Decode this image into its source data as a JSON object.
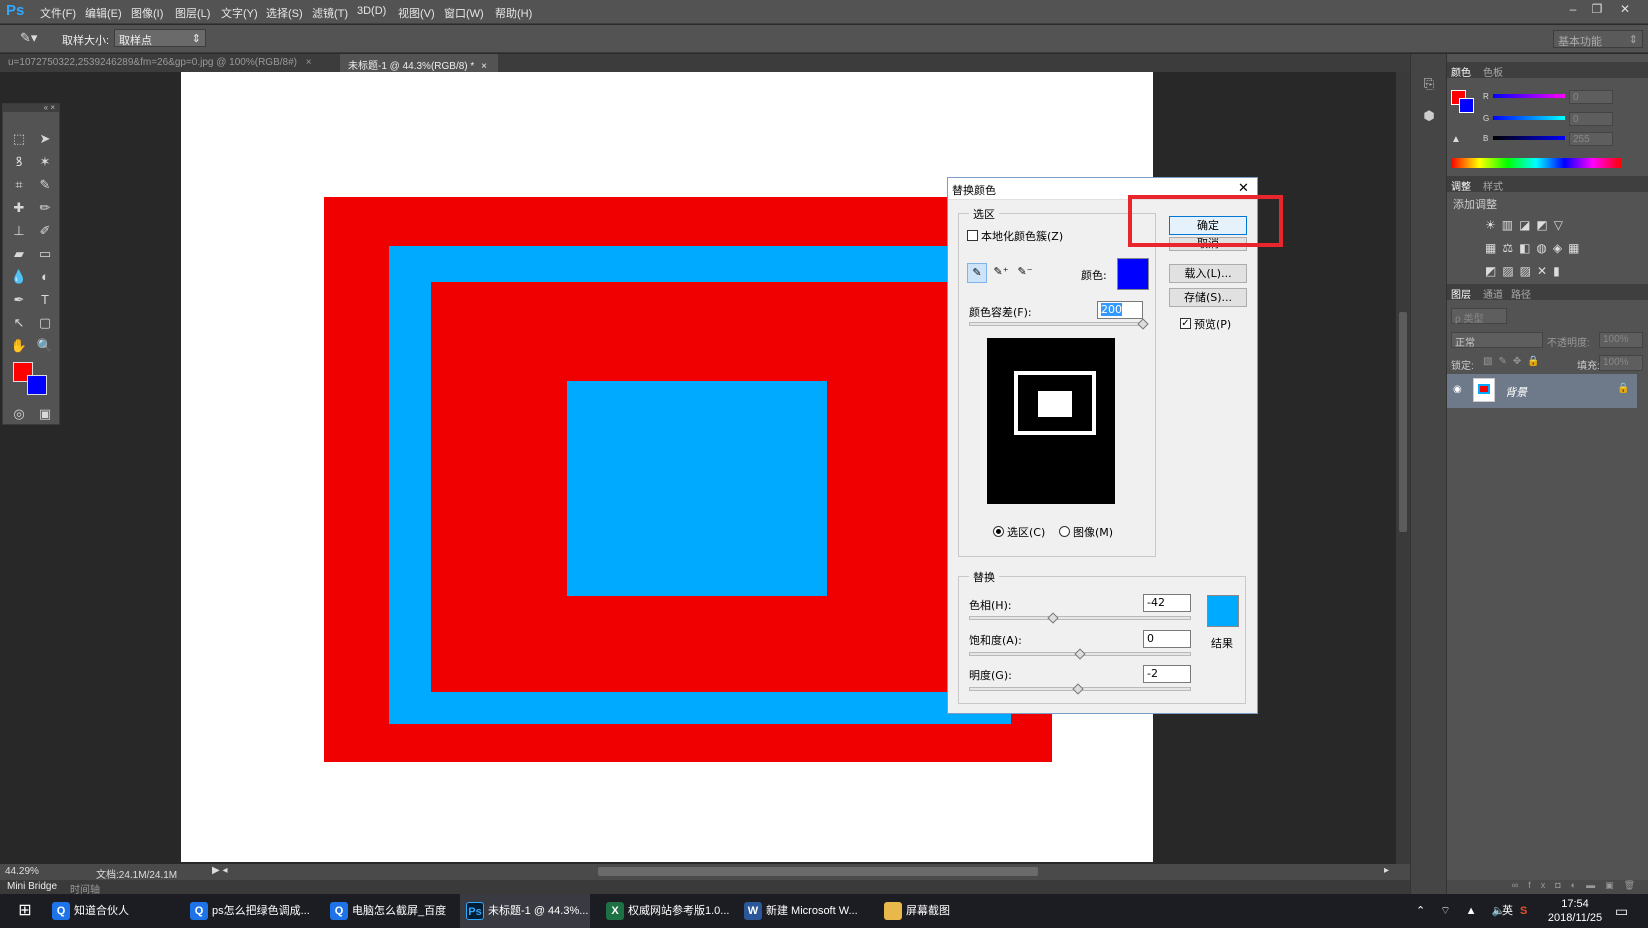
{
  "app": {
    "logo": "Ps"
  },
  "menu": [
    "文件(F)",
    "编辑(E)",
    "图像(I)",
    "图层(L)",
    "文字(Y)",
    "选择(S)",
    "滤镜(T)",
    "3D(D)",
    "视图(V)",
    "窗口(W)",
    "帮助(H)"
  ],
  "window_controls": {
    "minimize": "–",
    "restore": "❐",
    "close": "✕"
  },
  "options": {
    "sample_size_label": "取样大小:",
    "sample_size_value": "取样点",
    "workspace": "基本功能"
  },
  "tabs": [
    {
      "label": "u=1072750322,2539246289&fm=26&gp=0.jpg @ 100%(RGB/8#)",
      "close": "×"
    },
    {
      "label": "未标题-1 @ 44.3%(RGB/8) *",
      "close": "×"
    }
  ],
  "colors": {
    "red": "#f00000",
    "blue_light": "#00aaff",
    "fg": "#ff0000",
    "bg": "#0000ff"
  },
  "status": {
    "zoom": "44.29%",
    "doc": "文档:24.1M/24.1M"
  },
  "bottom_tabs": [
    "Mini Bridge",
    "时间轴"
  ],
  "panels": {
    "color_tabs": [
      "颜色",
      "色板"
    ],
    "rgb": [
      {
        "label": "R",
        "value": "0"
      },
      {
        "label": "G",
        "value": "0"
      },
      {
        "label": "B",
        "value": "255"
      }
    ],
    "adjust_tabs": [
      "调整",
      "样式"
    ],
    "adjust_title": "添加调整",
    "layer_tabs": [
      "图层",
      "通道",
      "路径"
    ],
    "layer_filter": "ρ 类型",
    "blend_mode": "正常",
    "opacity_label": "不透明度:",
    "opacity_value": "100%",
    "lock_label": "锁定:",
    "fill_label": "填充:",
    "fill_value": "100%",
    "layer_name": "背景"
  },
  "dialog": {
    "title": "替换颜色",
    "close": "✕",
    "selection_group": "选区",
    "localized_label": "本地化颜色簇(Z)",
    "color_label": "颜色:",
    "color_swatch": "#0000ff",
    "fuzziness_label": "颜色容差(F):",
    "fuzziness_value": "200",
    "fuzziness_fraction": 1.0,
    "radio_selection": "选区(C)",
    "radio_image": "图像(M)",
    "replace_group": "替换",
    "hue_label": "色相(H):",
    "hue_value": "-42",
    "sat_label": "饱和度(A):",
    "sat_value": "0",
    "light_label": "明度(G):",
    "light_value": "-2",
    "result_label": "结果",
    "result_swatch": "#00aaff",
    "ok": "确定",
    "cancel": "取消",
    "load": "载入(L)...",
    "save": "存储(S)...",
    "preview": "预览(P)"
  },
  "taskbar": {
    "items": [
      "知道合伙人",
      "ps怎么把绿色调成...",
      "电脑怎么截屏_百度",
      "未标题-1 @ 44.3%...",
      "权威网站参考版1.0...",
      "新建 Microsoft W...",
      "屏幕截图"
    ],
    "tray_lang": "英",
    "time": "17:54",
    "date": "2018/11/25"
  }
}
